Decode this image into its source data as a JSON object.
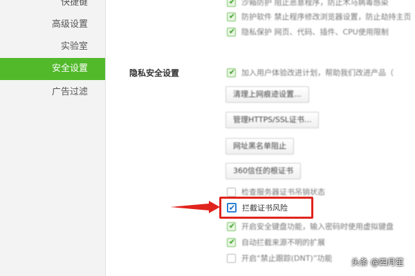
{
  "sidebar": {
    "items": [
      {
        "label": "快捷键",
        "active": false
      },
      {
        "label": "高级设置",
        "active": false
      },
      {
        "label": "实验室",
        "active": false
      },
      {
        "label": "安全设置",
        "active": true
      },
      {
        "label": "广告过滤",
        "active": false
      }
    ]
  },
  "top_options": [
    {
      "label": "沙箱防护  阻止恶意程序，防止木马病毒感染",
      "checked": true
    },
    {
      "label": "防护软件  禁止程序修改浏览器设置，防止劫持主页",
      "checked": true
    },
    {
      "label": "隐私保护  网页、代码、插件、CPU使用限制",
      "checked": true
    }
  ],
  "privacy": {
    "section_label": "隐私安全设置",
    "first_option": {
      "label": "加入用户体验改进计划，帮助我们改进产品（",
      "checked": true
    },
    "buttons": [
      "清理上网痕迹设置...",
      "管理HTTPS/SSL证书...",
      "网址黑名单阻止",
      "360信任的根证书"
    ],
    "options": [
      {
        "label": "检查服务器证书吊销状态",
        "checked": false
      },
      {
        "label": "拦截证书风险",
        "checked": true,
        "highlighted": true
      },
      {
        "label": "开启安全键盘功能，输入密码时使用虚拟键盘",
        "checked": true
      },
      {
        "label": "自动拦截来源不明的扩展",
        "checked": true
      },
      {
        "label": "开启“禁止跟踪(DNT)”功能",
        "checked": false
      }
    ]
  },
  "watermark": "头条 @四月笙",
  "colors": {
    "accent_green": "#52b92b",
    "highlight_red": "#e0231c",
    "arrow_red": "#e0231c"
  },
  "icons": [
    "checkbox-tick-icon",
    "red-arrow-icon"
  ]
}
